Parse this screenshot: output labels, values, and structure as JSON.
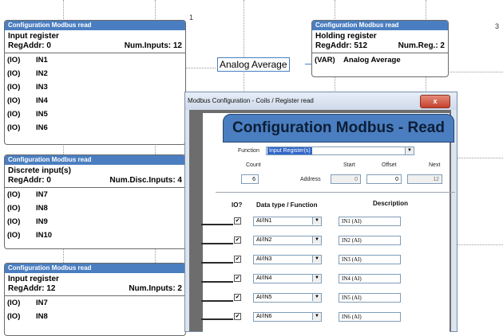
{
  "canvas": {
    "numbers": [
      "1",
      "3"
    ]
  },
  "blocks": [
    {
      "title": "Configuration Modbus read",
      "type": "Input register",
      "addr": "RegAddr:  0",
      "count": "Num.Inputs: 12",
      "rows": [
        {
          "tag": "(IO)",
          "name": "IN1"
        },
        {
          "tag": "(IO)",
          "name": "IN2"
        },
        {
          "tag": "(IO)",
          "name": "IN3"
        },
        {
          "tag": "(IO)",
          "name": "IN4"
        },
        {
          "tag": "(IO)",
          "name": "IN5"
        },
        {
          "tag": "(IO)",
          "name": "IN6"
        }
      ]
    },
    {
      "title": "Configuration Modbus read",
      "type": "Discrete input(s)",
      "addr": "RegAddr:  0",
      "count": "Num.Disc.Inputs: 4",
      "rows": [
        {
          "tag": "(IO)",
          "name": "IN7"
        },
        {
          "tag": "(IO)",
          "name": "IN8"
        },
        {
          "tag": "(IO)",
          "name": "IN9"
        },
        {
          "tag": "(IO)",
          "name": "IN10"
        }
      ]
    },
    {
      "title": "Configuration Modbus read",
      "type": "Input register",
      "addr": "RegAddr:  12",
      "count": "Num.Inputs: 2",
      "rows": [
        {
          "tag": "(IO)",
          "name": "IN7"
        },
        {
          "tag": "(IO)",
          "name": "IN8"
        }
      ]
    },
    {
      "title": "Configuration Modbus read",
      "type": "Holding register",
      "addr": "RegAddr:  512",
      "count": "Num.Reg.: 2",
      "rows": [
        {
          "tag": "(VAR)",
          "name": "Analog Average"
        }
      ]
    }
  ],
  "analog_tag": "Analog Average",
  "dialog": {
    "title": "Modbus Configuration - Coils / Register read",
    "close": "x",
    "banner": "Configuration Modbus - Read",
    "function_label": "Function",
    "function_value": "Input Register(s)",
    "count_label": "Count",
    "count_value": "6",
    "address_label": "Address",
    "start_label": "Start",
    "start_value": "0",
    "offset_label": "Offset",
    "offset_value": "0",
    "next_label": "Next",
    "next_value": "12",
    "col_io": "IO?",
    "col_type": "Data type / Function",
    "col_desc": "Description",
    "check_mark": "✔",
    "rows": [
      {
        "type": "AI/IN1",
        "desc": "IN1 (AI)"
      },
      {
        "type": "AI/IN2",
        "desc": "IN2 (AI)"
      },
      {
        "type": "AI/IN3",
        "desc": "IN3 (AI)"
      },
      {
        "type": "AI/IN4",
        "desc": "IN4 (AI)"
      },
      {
        "type": "AI/IN5",
        "desc": "IN5 (AI)"
      },
      {
        "type": "AI/IN6",
        "desc": "IN6 (AI)"
      }
    ]
  }
}
